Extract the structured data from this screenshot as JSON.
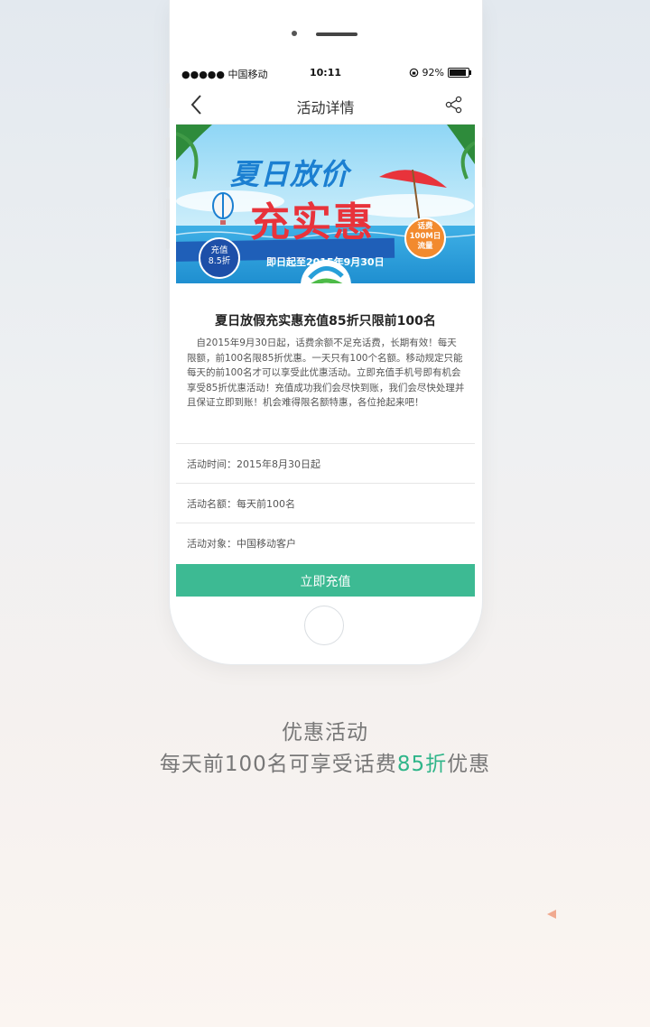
{
  "status_bar": {
    "carrier": "●●●●● 中国移动",
    "time": "10:11",
    "battery_text": "92%",
    "battery_level": 0.92
  },
  "nav": {
    "title": "活动详情",
    "back_icon": "chevron-left-icon",
    "share_icon": "share-icon"
  },
  "banner": {
    "headline_top": "夏日放价",
    "headline_main": "充实惠",
    "badge_left_line1": "充值",
    "badge_left_line2": "8.5折",
    "badge_right_line1": "话费",
    "badge_right_line2": "100M日",
    "badge_right_line3": "流量",
    "date_ribbon": "即日起至2015年9月30日",
    "logo": "china-mobile-logo",
    "colors": {
      "sky": "#6fc6ee",
      "sea": "#2a9fd8",
      "ribbon": "#1f5fb8",
      "headline_red": "#e8333b",
      "headline_blue": "#1b7fd1"
    }
  },
  "article": {
    "title": "夏日放假充实惠充值85折只限前100名",
    "body": "自2015年9月30日起，话费余额不足充话费，长期有效！每天限额，前100名限85折优惠。一天只有100个名额。移动规定只能每天的前100名才可以享受此优惠活动。立即充值手机号即有机会享受85折优惠活动！充值成功我们会尽快到账，我们会尽快处理并且保证立即到账！机会难得限名额特惠，各位抢起来吧！"
  },
  "info": [
    {
      "text": "活动时间：2015年8月30日起"
    },
    {
      "text": "活动名额：每天前100名"
    },
    {
      "text": "活动对象：中国移动客户"
    }
  ],
  "cta": {
    "label": "立即充值",
    "color": "#3dba93"
  },
  "caption": {
    "title": "优惠活动",
    "sub_before": "每天前100名可享受话费",
    "sub_highlight": "85折",
    "sub_after": "优惠",
    "highlight_color": "#2fb589"
  }
}
